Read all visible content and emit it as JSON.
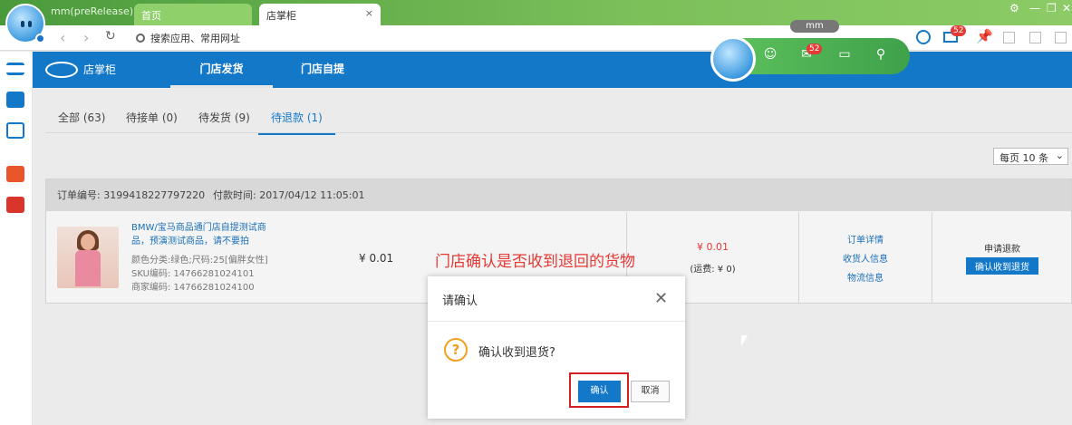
{
  "window": {
    "app_title": "mm(preRelease)",
    "tabs": [
      "首页",
      "店掌柜"
    ]
  },
  "addressbar": {
    "search_text": "搜索应用、常用网址"
  },
  "mm_pill": "mm",
  "toolbar_badge": "52",
  "float_badge": "52",
  "topnav": {
    "brand": "店掌柜",
    "items": [
      "门店发货",
      "门店自提"
    ]
  },
  "subtabs": [
    "全部 (63)",
    "待接单 (0)",
    "待发货 (9)",
    "待退款 (1)"
  ],
  "perpage": "每页 10 条",
  "order": {
    "number": "订单编号: 3199418227797220",
    "paytime": "付款时间: 2017/04/12 11:05:01",
    "product_name": "BMW/宝马商品通门店自提测试商品，预演测试商品，请不要拍",
    "spec": "颜色分类:绿色;尺码:25[偏胖女性]",
    "sku": "SKU编码: 14766281024101",
    "merchant_code": "商家编码: 14766281024100",
    "price": "¥ 0.01",
    "total": "¥ 0.01",
    "shipping": "(运费: ¥ 0)",
    "links": [
      "订单详情",
      "收货人信息",
      "物流信息"
    ],
    "status": "申请退款",
    "action": "确认收到退货"
  },
  "annotation": "门店确认是否收到退回的货物",
  "dialog": {
    "title": "请确认",
    "message": "确认收到退货?",
    "ok": "确认",
    "cancel": "取消"
  }
}
